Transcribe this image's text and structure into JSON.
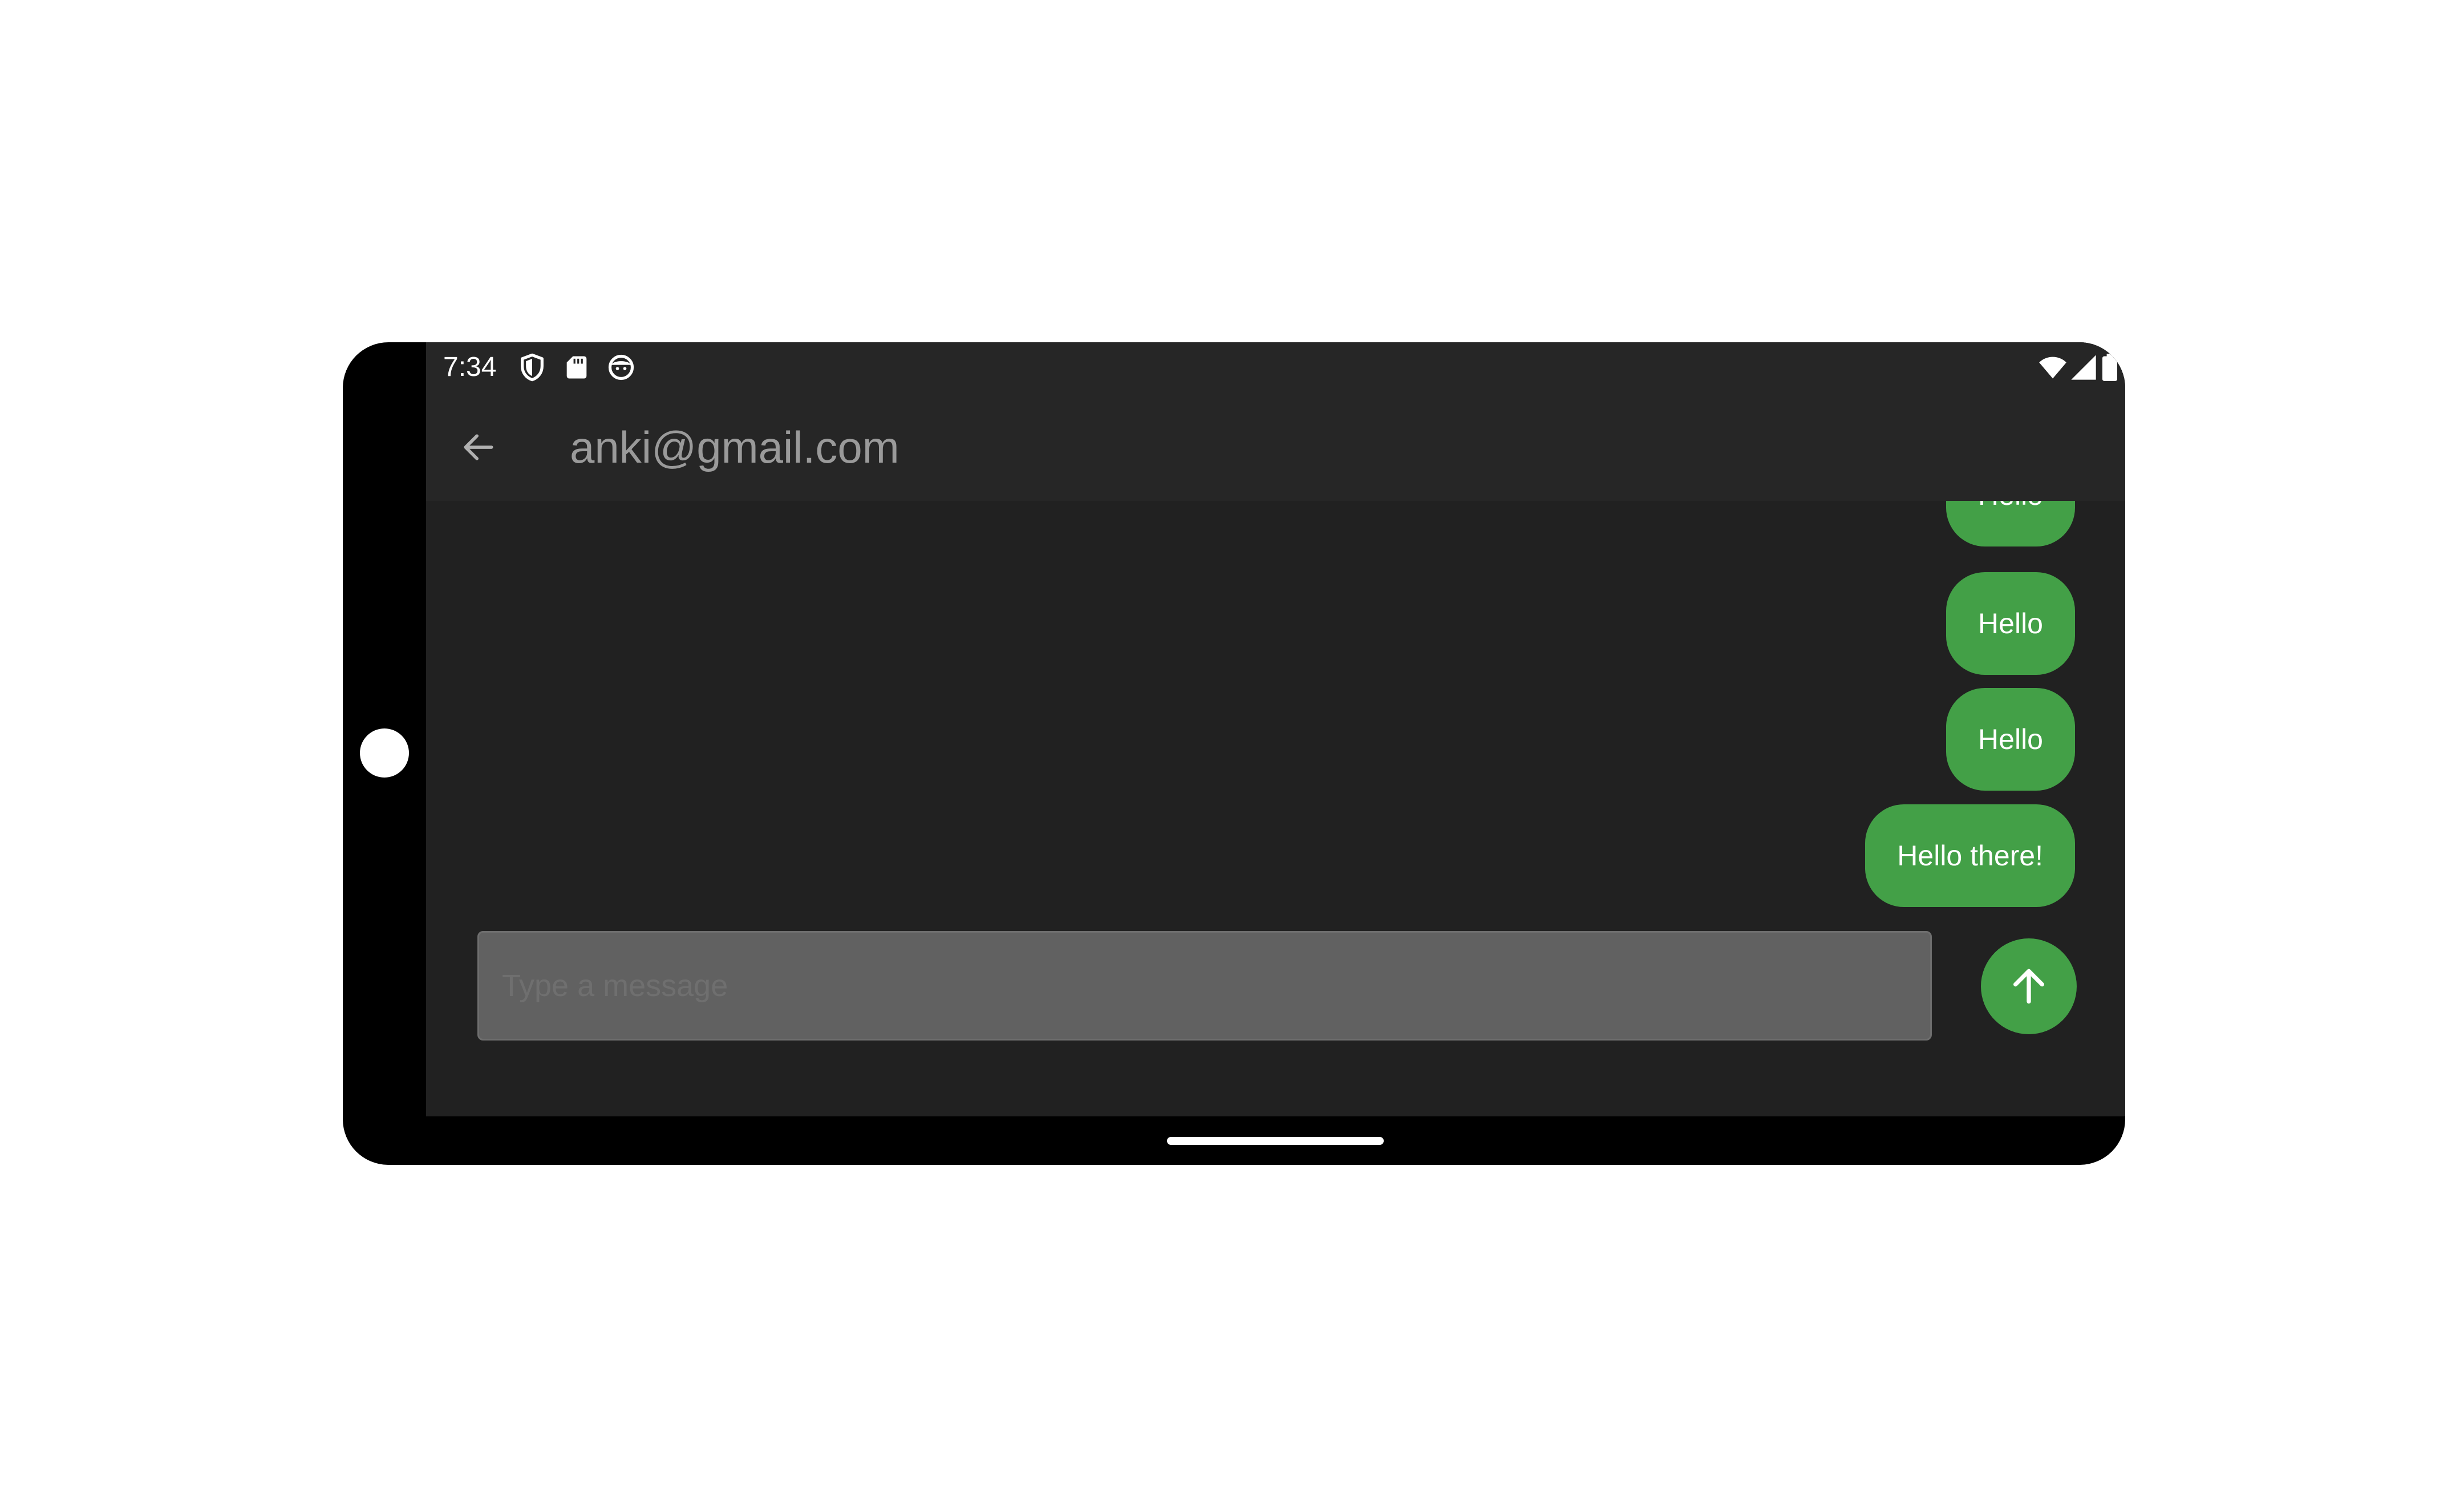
{
  "status_bar": {
    "time": "7:34",
    "left_icons": [
      "shield-icon",
      "sd-card-icon",
      "face-icon"
    ],
    "right_icons": [
      "wifi-icon",
      "cell-signal-icon",
      "battery-icon"
    ]
  },
  "app_bar": {
    "back_icon": "arrow-back-icon",
    "title": "anki@gmail.com"
  },
  "messages": [
    {
      "text": "Hello"
    },
    {
      "text": "Hello"
    },
    {
      "text": "Hello"
    },
    {
      "text": "Hello there!"
    }
  ],
  "composer": {
    "placeholder": "Type a message",
    "value": "",
    "send_icon": "arrow-upward-icon"
  },
  "colors": {
    "accent": "#43a047",
    "background": "#212121",
    "bar": "#262626",
    "input": "#616161"
  }
}
